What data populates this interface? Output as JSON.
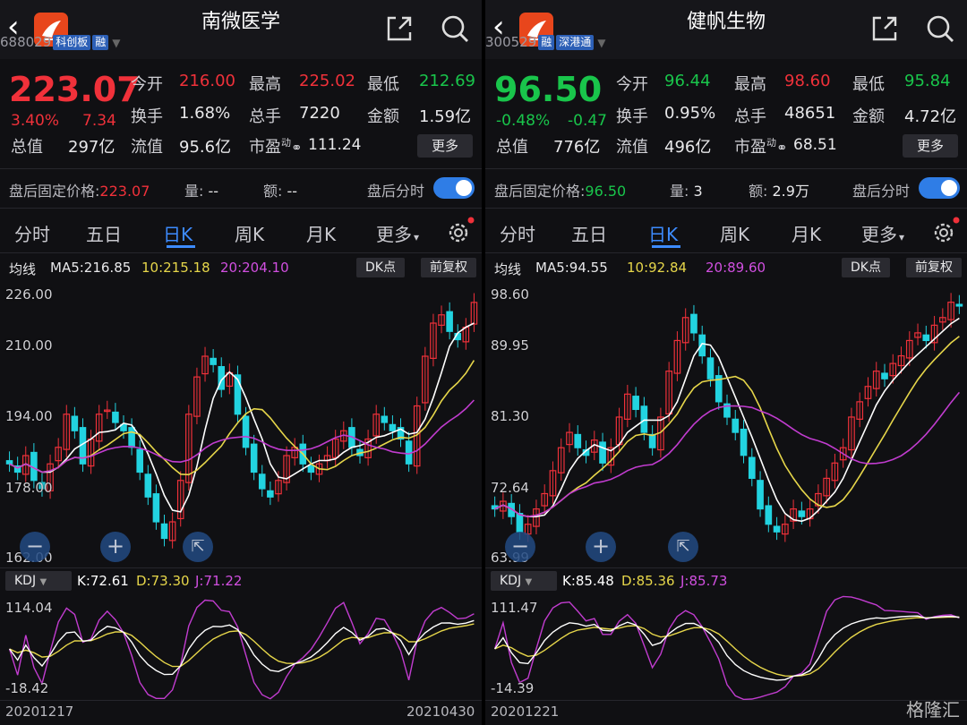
{
  "panels": [
    {
      "name": "南微医学",
      "code": "688029",
      "badges": [
        "科创板",
        "融"
      ],
      "price": "223.07",
      "pct": "3.40%",
      "chg": "7.34",
      "trend": "up",
      "stats": [
        {
          "label": "今开",
          "value": "216.00",
          "color": "red"
        },
        {
          "label": "最高",
          "value": "225.02",
          "color": "red"
        },
        {
          "label": "最低",
          "value": "212.69",
          "color": "green"
        },
        {
          "label": "换手",
          "value": "1.68%",
          "color": "white"
        },
        {
          "label": "总手",
          "value": "7220",
          "color": "white"
        },
        {
          "label": "金额",
          "value": "1.59亿",
          "color": "white"
        },
        {
          "label": "总值",
          "value": "297亿",
          "color": "white"
        },
        {
          "label": "流值",
          "value": "95.6亿",
          "color": "white"
        }
      ],
      "pe_label": "市盈",
      "pe_sup": "动",
      "pe_value": "111.24",
      "more_label": "更多",
      "after_price_label": "盘后固定价格:",
      "after_price": "223.07",
      "after_vol_label": "量:",
      "after_vol": "--",
      "after_amt_label": "额:",
      "after_amt": "--",
      "after_trend_label": "盘后分时",
      "tabs": [
        "分时",
        "五日",
        "日K",
        "周K",
        "月K",
        "更多"
      ],
      "active_tab": "日K",
      "ma_label": "均线",
      "ma5": "MA5:216.85",
      "ma10": "10:215.18",
      "ma20": "20:204.10",
      "dk_label": "DK点",
      "adjust_label": "前复权",
      "price_axis": [
        "226.00",
        "210.00",
        "194.00",
        "178.00",
        "162.00"
      ],
      "kdj_label": "KDJ",
      "k": "K:72.61",
      "d": "D:73.30",
      "j": "J:71.22",
      "kdj_axis": [
        "114.04",
        "-18.42"
      ],
      "date_start": "20201217",
      "date_end": "20210430"
    },
    {
      "name": "健帆生物",
      "code": "300529",
      "badges": [
        "融",
        "深港通"
      ],
      "price": "96.50",
      "pct": "-0.48%",
      "chg": "-0.47",
      "trend": "down",
      "stats": [
        {
          "label": "今开",
          "value": "96.44",
          "color": "green"
        },
        {
          "label": "最高",
          "value": "98.60",
          "color": "red"
        },
        {
          "label": "最低",
          "value": "95.84",
          "color": "green"
        },
        {
          "label": "换手",
          "value": "0.95%",
          "color": "white"
        },
        {
          "label": "总手",
          "value": "48651",
          "color": "white"
        },
        {
          "label": "金额",
          "value": "4.72亿",
          "color": "white"
        },
        {
          "label": "总值",
          "value": "776亿",
          "color": "white"
        },
        {
          "label": "流值",
          "value": "496亿",
          "color": "white"
        }
      ],
      "pe_label": "市盈",
      "pe_sup": "动",
      "pe_value": "68.51",
      "more_label": "更多",
      "after_price_label": "盘后固定价格:",
      "after_price": "96.50",
      "after_vol_label": "量:",
      "after_vol": "3",
      "after_amt_label": "额:",
      "after_amt": "2.9万",
      "after_trend_label": "盘后分时",
      "tabs": [
        "分时",
        "五日",
        "日K",
        "周K",
        "月K",
        "更多"
      ],
      "active_tab": "日K",
      "ma_label": "均线",
      "ma5": "MA5:94.55",
      "ma10": "10:92.84",
      "ma20": "20:89.60",
      "dk_label": "DK点",
      "adjust_label": "前复权",
      "price_axis": [
        "98.60",
        "89.95",
        "81.30",
        "72.64",
        "63.99"
      ],
      "kdj_label": "KDJ",
      "k": "K:85.48",
      "d": "D:85.36",
      "j": "J:85.73",
      "kdj_axis": [
        "111.47",
        "-14.39"
      ],
      "date_start": "20201221",
      "date_end": ""
    }
  ],
  "colors": {
    "up": "#f0313a",
    "down": "#19c54b",
    "accent": "#3d8bff",
    "candle_down": "#22d3e0",
    "ma5": "#ffffff",
    "ma10": "#e6d64a",
    "ma20": "#c13ccf"
  },
  "watermark": "格隆汇",
  "chart_data": [
    {
      "type": "candlestick",
      "title": "南微医学 日K",
      "x_range": [
        "20201217",
        "20210430"
      ],
      "ylim": [
        162.0,
        226.0
      ],
      "series_close_approx": [
        184,
        182,
        186,
        180,
        178,
        184,
        188,
        196,
        192,
        184,
        190,
        196,
        197,
        194,
        192,
        188,
        182,
        176,
        170,
        166,
        170,
        180,
        196,
        205,
        210,
        208,
        202,
        206,
        196,
        188,
        182,
        178,
        176,
        180,
        186,
        188,
        184,
        182,
        184,
        186,
        190,
        192,
        188,
        186,
        190,
        196,
        194,
        192,
        190,
        184,
        198,
        210,
        218,
        220,
        216,
        214,
        217,
        223
      ]
    },
    {
      "type": "candlestick",
      "title": "健帆生物 日K",
      "x_range": [
        "20201221",
        ""
      ],
      "ylim": [
        63.99,
        98.6
      ],
      "series_close_approx": [
        70,
        71,
        69,
        67,
        68,
        70,
        72,
        75,
        78,
        80,
        78,
        77,
        79,
        76,
        78,
        82,
        85,
        83,
        80,
        78,
        82,
        88,
        92,
        95,
        93,
        90,
        87,
        84,
        82,
        80,
        77,
        74,
        70,
        68,
        67,
        68,
        70,
        69,
        70,
        72,
        74,
        76,
        78,
        82,
        84,
        86,
        88,
        87,
        89,
        90,
        92,
        93,
        92,
        94,
        95,
        97,
        96.5
      ]
    }
  ]
}
